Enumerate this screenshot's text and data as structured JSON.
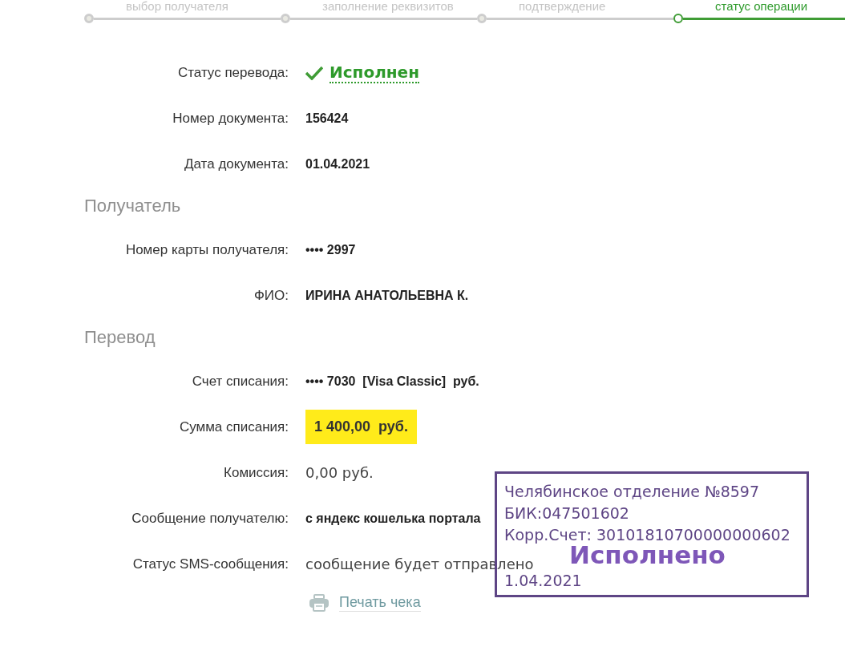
{
  "steps": [
    {
      "label": "выбор получателя",
      "selected": false
    },
    {
      "label": "заполнение реквизитов",
      "selected": false
    },
    {
      "label": "подтверждение",
      "selected": false
    },
    {
      "label": "статус операции",
      "selected": true
    }
  ],
  "sections": [
    {
      "fields": [
        {
          "label": "Статус перевода:",
          "value": "Исполнен",
          "kind": "status"
        },
        {
          "label": "Номер документа:",
          "value": "156424",
          "kind": "bold"
        },
        {
          "label": "Дата документа:",
          "value": "01.04.2021",
          "kind": "bold"
        }
      ]
    },
    {
      "title": "Получатель",
      "fields": [
        {
          "label": "Номер карты получателя:",
          "value": "•••• 2997",
          "kind": "bold"
        },
        {
          "label": "ФИО:",
          "value": "ИРИНА АНАТОЛЬЕВНА К.",
          "kind": "bold"
        }
      ]
    },
    {
      "title": "Перевод",
      "fields": [
        {
          "label": "Счет списания:",
          "value": "•••• 7030  [Visa Classic]  руб.",
          "kind": "bold"
        },
        {
          "label": "Сумма списания:",
          "value": "1 400,00  руб.",
          "kind": "highlight"
        },
        {
          "label": "Комиссия:",
          "value": "0,00 руб.",
          "kind": "plain"
        },
        {
          "label": "Сообщение получателю:",
          "value": "с яндекс кошелька портала",
          "kind": "bold"
        },
        {
          "label": "Статус SMS-сообщения:",
          "value": "сообщение будет отправлено",
          "kind": "plain"
        }
      ]
    }
  ],
  "print_link": "Печать чека",
  "stamp": {
    "lines": [
      "Челябинское отделение №8597",
      "БИК:047501602",
      "Корр.Счет: 30101810700000000602",
      "1.04.2021"
    ],
    "mark": "Исполнено"
  }
}
